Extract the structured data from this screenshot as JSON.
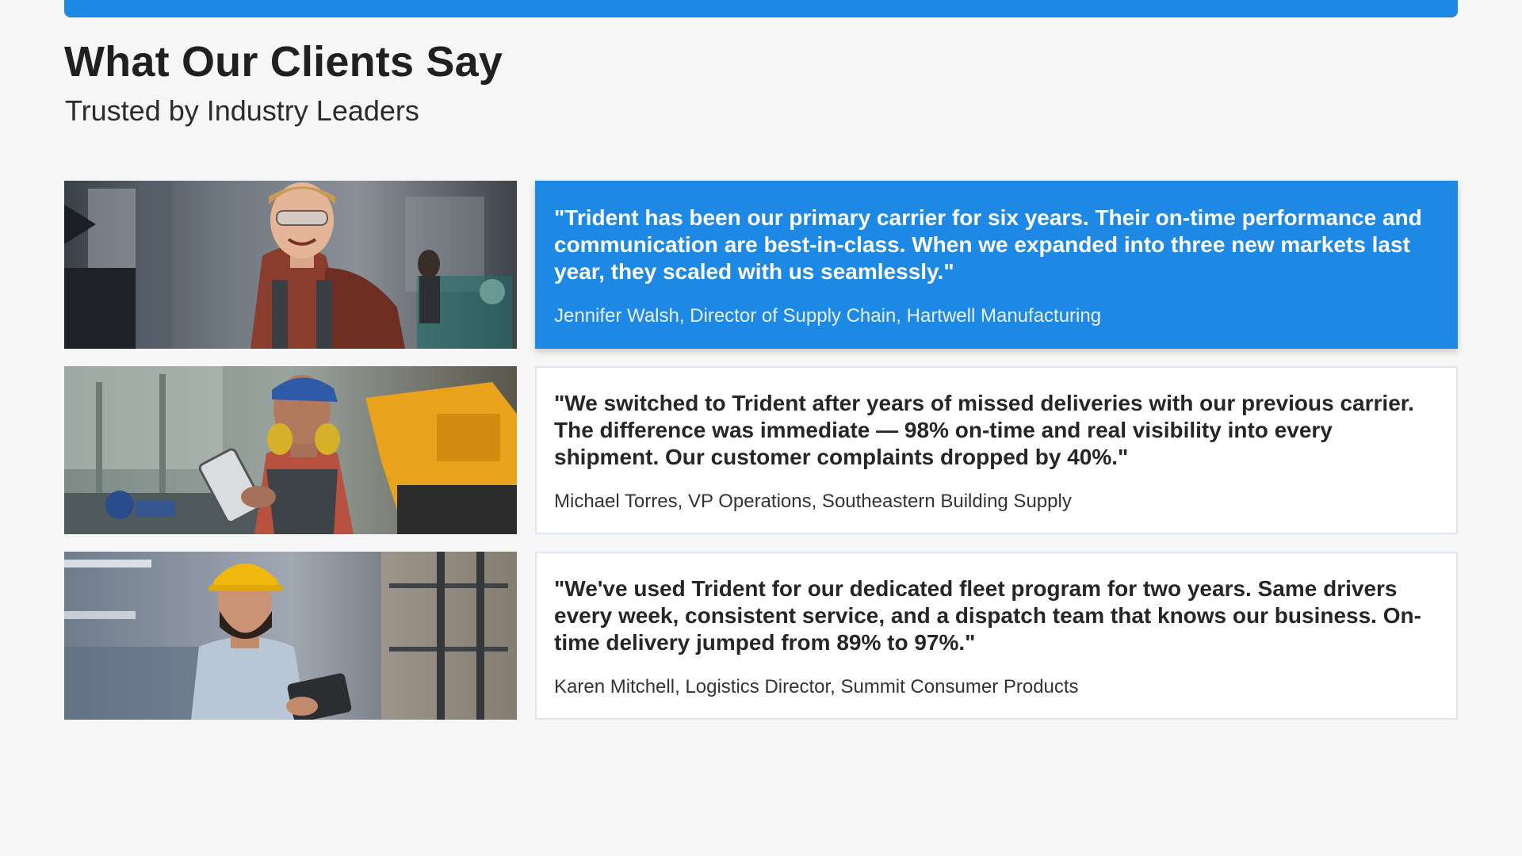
{
  "header": {
    "title": "What Our Clients Say",
    "subtitle": "Trusted by Industry Leaders"
  },
  "theme": {
    "accent": "#1e88e5",
    "background": "#f6f6f6",
    "card_border": "#dde6f0"
  },
  "testimonials": [
    {
      "quote": "\"Trident has been our primary carrier for six years. Their on-time performance and communication are best-in-class. When we expanded into three new markets last year, they scaled with us seamlessly.\"",
      "attribution": "Jennifer Walsh, Director of Supply Chain, Hartwell Manufacturing",
      "featured": true
    },
    {
      "quote": "\"We switched to Trident after years of missed deliveries with our previous carrier. The difference was immediate — 98% on-time and real visibility into every shipment. Our customer complaints dropped by 40%.\"",
      "attribution": "Michael Torres, VP Operations, Southeastern Building Supply",
      "featured": false
    },
    {
      "quote": "\"We've used Trident for our dedicated fleet program for two years. Same drivers every week, consistent service, and a dispatch team that knows our business. On-time delivery jumped from 89% to 97%.\"",
      "attribution": "Karen Mitchell, Logistics Director, Summit Consumer Products",
      "featured": false
    }
  ]
}
